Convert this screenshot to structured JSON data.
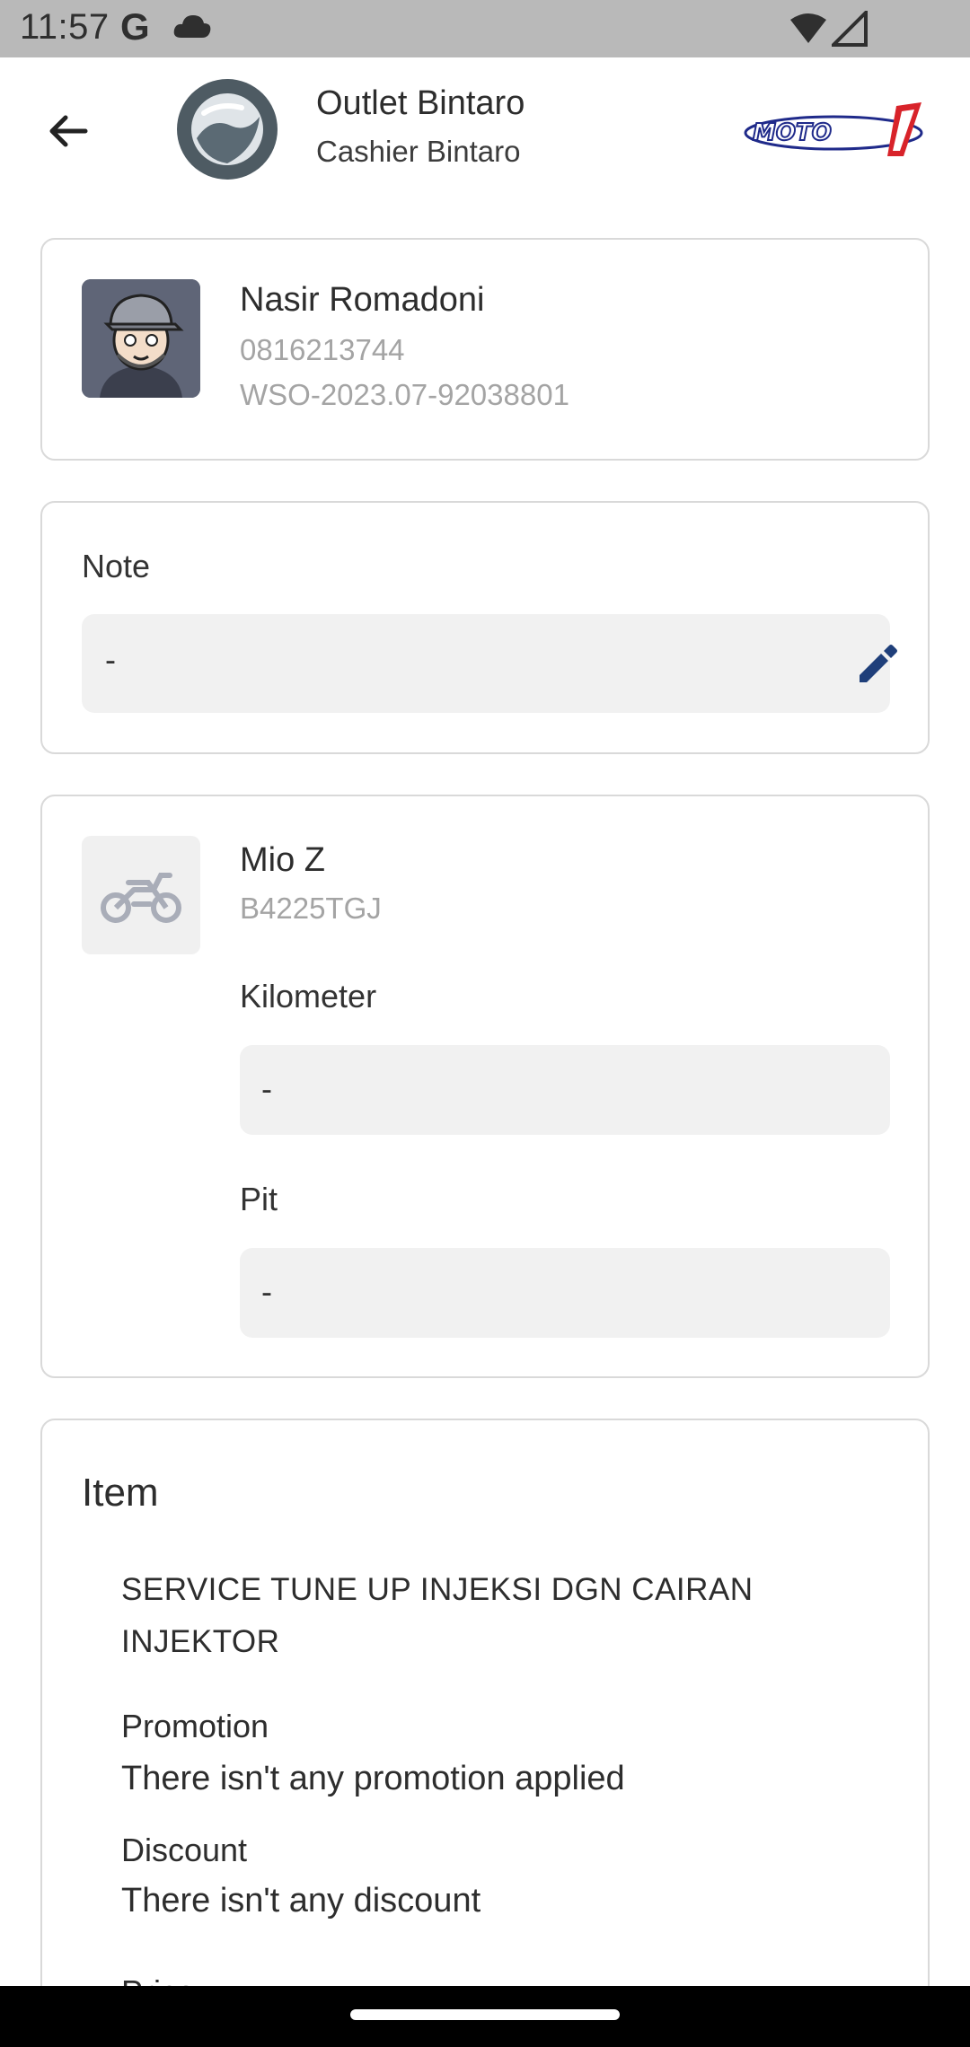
{
  "status_bar": {
    "time": "11:57",
    "g_label": "G"
  },
  "header": {
    "outlet_name": "Outlet Bintaro",
    "cashier_name": "Cashier Bintaro",
    "brand_logo": "MOTO 1"
  },
  "customer": {
    "name": "Nasir Romadoni",
    "phone": "0816213744",
    "order_id": "WSO-2023.07-92038801"
  },
  "note": {
    "label": "Note",
    "value": "-"
  },
  "vehicle": {
    "name": "Mio Z",
    "plate": "B4225TGJ",
    "kilometer_label": "Kilometer",
    "kilometer_value": "-",
    "pit_label": "Pit",
    "pit_value": "-"
  },
  "item": {
    "title": "Item",
    "name": "SERVICE TUNE UP INJEKSI DGN CAIRAN INJEKTOR",
    "promotion_label": "Promotion",
    "promotion_value": "There isn't any promotion applied",
    "discount_label": "Discount",
    "discount_value": "There isn't any discount",
    "price_label": "Price"
  },
  "colors": {
    "accent_edit": "#1f3f7a",
    "status_bar": "#b9b9b9",
    "field_bg": "#f1f1f1",
    "card_border": "#d9d9d9"
  }
}
